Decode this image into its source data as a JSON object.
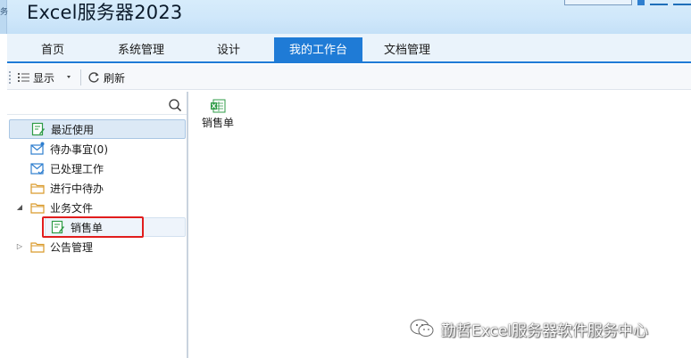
{
  "app": {
    "header_left_glyph": "务",
    "title": "Excel服务器2023"
  },
  "tabs": [
    {
      "label": "首页",
      "active": false
    },
    {
      "label": "系统管理",
      "active": false
    },
    {
      "label": "设计",
      "active": false
    },
    {
      "label": "我的工作台",
      "active": true
    },
    {
      "label": "文档管理",
      "active": false
    }
  ],
  "toolbar": {
    "display_label": "显示",
    "refresh_label": "刷新"
  },
  "left_panel": {
    "search": {
      "value": "",
      "placeholder": ""
    },
    "tree": [
      {
        "label": "最近使用",
        "icon": "edit-form-icon",
        "state": "selected"
      },
      {
        "label": "待办事宜(0)",
        "icon": "mail-notify-icon"
      },
      {
        "label": "已处理工作",
        "icon": "mail-check-icon"
      },
      {
        "label": "进行中待办",
        "icon": "folder-icon"
      },
      {
        "label": "业务文件",
        "icon": "folder-icon",
        "expanded": true
      },
      {
        "label": "销售单",
        "icon": "edit-form-icon",
        "state": "hover",
        "child": true
      },
      {
        "label": "公告管理",
        "icon": "folder-icon",
        "expanded": false
      }
    ]
  },
  "right_panel": {
    "items": [
      {
        "label": "销售单",
        "icon": "excel-form-icon"
      }
    ]
  },
  "watermark": {
    "text": "勤哲Excel服务器软件服务中心",
    "icon": "wechat-icon"
  },
  "colors": {
    "accent": "#1f7bd6",
    "highlight": "#e11d1d",
    "form_icon": "#2e9b46",
    "folder_icon": "#d99a2b",
    "mail_icon": "#2f7fcf"
  }
}
